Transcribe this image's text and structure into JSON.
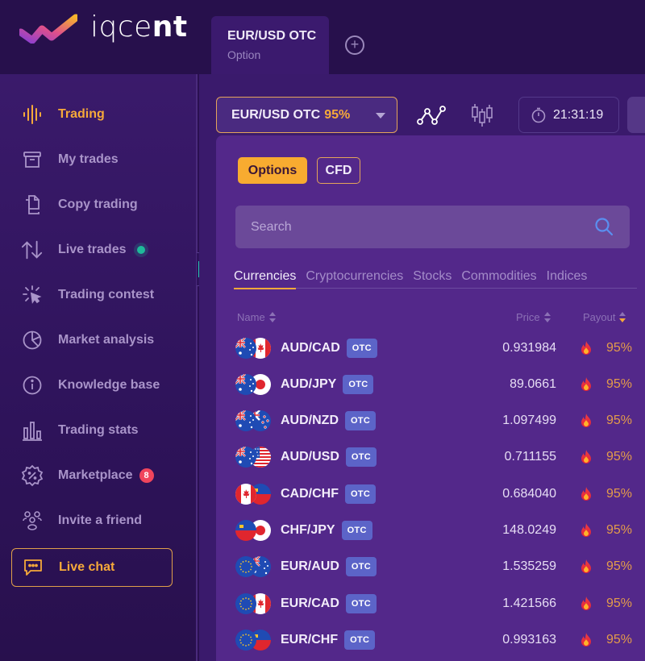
{
  "brand": {
    "name_light": "iqce",
    "name_bold": "nt"
  },
  "asset_tab": {
    "title": "EUR/USD OTC",
    "subtitle": "Option"
  },
  "sidebar": {
    "items": [
      {
        "label": "Trading",
        "icon": "trading-waveform-icon",
        "active": true
      },
      {
        "label": "My trades",
        "icon": "archive-box-icon"
      },
      {
        "label": "Copy trading",
        "icon": "copy-documents-icon"
      },
      {
        "label": "Live trades",
        "icon": "arrows-up-down-icon",
        "live_indicator": true
      },
      {
        "label": "Trading contest",
        "icon": "cursor-click-icon"
      },
      {
        "label": "Market analysis",
        "icon": "pie-chart-icon"
      },
      {
        "label": "Knowledge base",
        "icon": "info-circle-icon"
      },
      {
        "label": "Trading stats",
        "icon": "bar-chart-icon"
      },
      {
        "label": "Marketplace",
        "icon": "discount-badge-icon",
        "badge": "8"
      },
      {
        "label": "Invite a friend",
        "icon": "people-group-icon"
      },
      {
        "label": "Live chat",
        "icon": "chat-bubble-icon",
        "highlighted": true
      }
    ]
  },
  "toolbar": {
    "asset_name": "EUR/USD OTC",
    "asset_payout": "95%",
    "time": "21:31:19"
  },
  "asset_picker": {
    "types": [
      "Options",
      "CFD"
    ],
    "active_type": "Options",
    "search_placeholder": "Search",
    "search_value": "",
    "categories": [
      "Currencies",
      "Cryptocurrencies",
      "Stocks",
      "Commodities",
      "Indices"
    ],
    "active_category": "Currencies",
    "columns": {
      "name": "Name",
      "price": "Price",
      "payout": "Payout"
    },
    "rows": [
      {
        "pair": "AUD/CAD",
        "tag": "OTC",
        "price": "0.931984",
        "payout": "95%",
        "flags": [
          "AU",
          "CA"
        ]
      },
      {
        "pair": "AUD/JPY",
        "tag": "OTC",
        "price": "89.0661",
        "payout": "95%",
        "flags": [
          "AU",
          "JP"
        ]
      },
      {
        "pair": "AUD/NZD",
        "tag": "OTC",
        "price": "1.097499",
        "payout": "95%",
        "flags": [
          "AU",
          "NZ"
        ]
      },
      {
        "pair": "AUD/USD",
        "tag": "OTC",
        "price": "0.711155",
        "payout": "95%",
        "flags": [
          "AU",
          "US"
        ]
      },
      {
        "pair": "CAD/CHF",
        "tag": "OTC",
        "price": "0.684040",
        "payout": "95%",
        "flags": [
          "CA",
          "CH"
        ]
      },
      {
        "pair": "CHF/JPY",
        "tag": "OTC",
        "price": "148.0249",
        "payout": "95%",
        "flags": [
          "CH",
          "JP"
        ]
      },
      {
        "pair": "EUR/AUD",
        "tag": "OTC",
        "price": "1.535259",
        "payout": "95%",
        "flags": [
          "EU",
          "AU"
        ]
      },
      {
        "pair": "EUR/CAD",
        "tag": "OTC",
        "price": "1.421566",
        "payout": "95%",
        "flags": [
          "EU",
          "CA"
        ]
      },
      {
        "pair": "EUR/CHF",
        "tag": "OTC",
        "price": "0.993163",
        "payout": "95%",
        "flags": [
          "EU",
          "CH"
        ]
      }
    ]
  },
  "colors": {
    "accent": "#f6a93a",
    "panel": "#53288a",
    "background": "#27104c",
    "otc_badge": "#5c64c8",
    "live_dot": "#1fb99a",
    "badge_red": "#f0455c"
  }
}
